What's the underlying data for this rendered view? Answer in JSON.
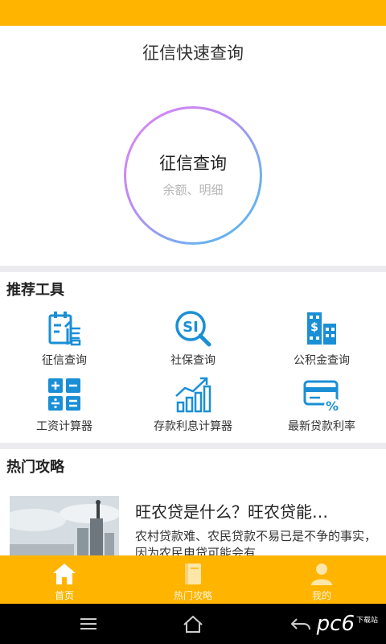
{
  "hero": {
    "title": "征信快速查询",
    "circle_title": "征信查询",
    "circle_subtitle": "余额、明细"
  },
  "tools_section": {
    "title": "推荐工具",
    "items": [
      {
        "label": "征信查询",
        "icon": "credit-report-icon"
      },
      {
        "label": "社保查询",
        "icon": "social-security-search-icon"
      },
      {
        "label": "公积金查询",
        "icon": "building-fund-icon"
      },
      {
        "label": "工资计算器",
        "icon": "calculator-icon"
      },
      {
        "label": "存款利息计算器",
        "icon": "growth-chart-icon"
      },
      {
        "label": "最新贷款利率",
        "icon": "card-percent-icon"
      }
    ]
  },
  "hot_section": {
    "title": "热门攻略",
    "articles": [
      {
        "title": "旺农贷是什么？旺农贷能…",
        "summary": "农村贷款难、农民贷款不易已是不争的事实，因为农民电贷可能会有"
      }
    ]
  },
  "tabbar": {
    "tabs": [
      {
        "label": "首页",
        "icon": "home-icon",
        "active": true
      },
      {
        "label": "热门攻略",
        "icon": "book-icon",
        "active": false
      },
      {
        "label": "我的",
        "icon": "user-icon",
        "active": false
      }
    ]
  },
  "colors": {
    "accent": "#ffb400",
    "icon_blue": "#1a8fd6",
    "divider": "#ebebf0"
  },
  "watermark": {
    "text": "pc6",
    "small": "下载站"
  }
}
